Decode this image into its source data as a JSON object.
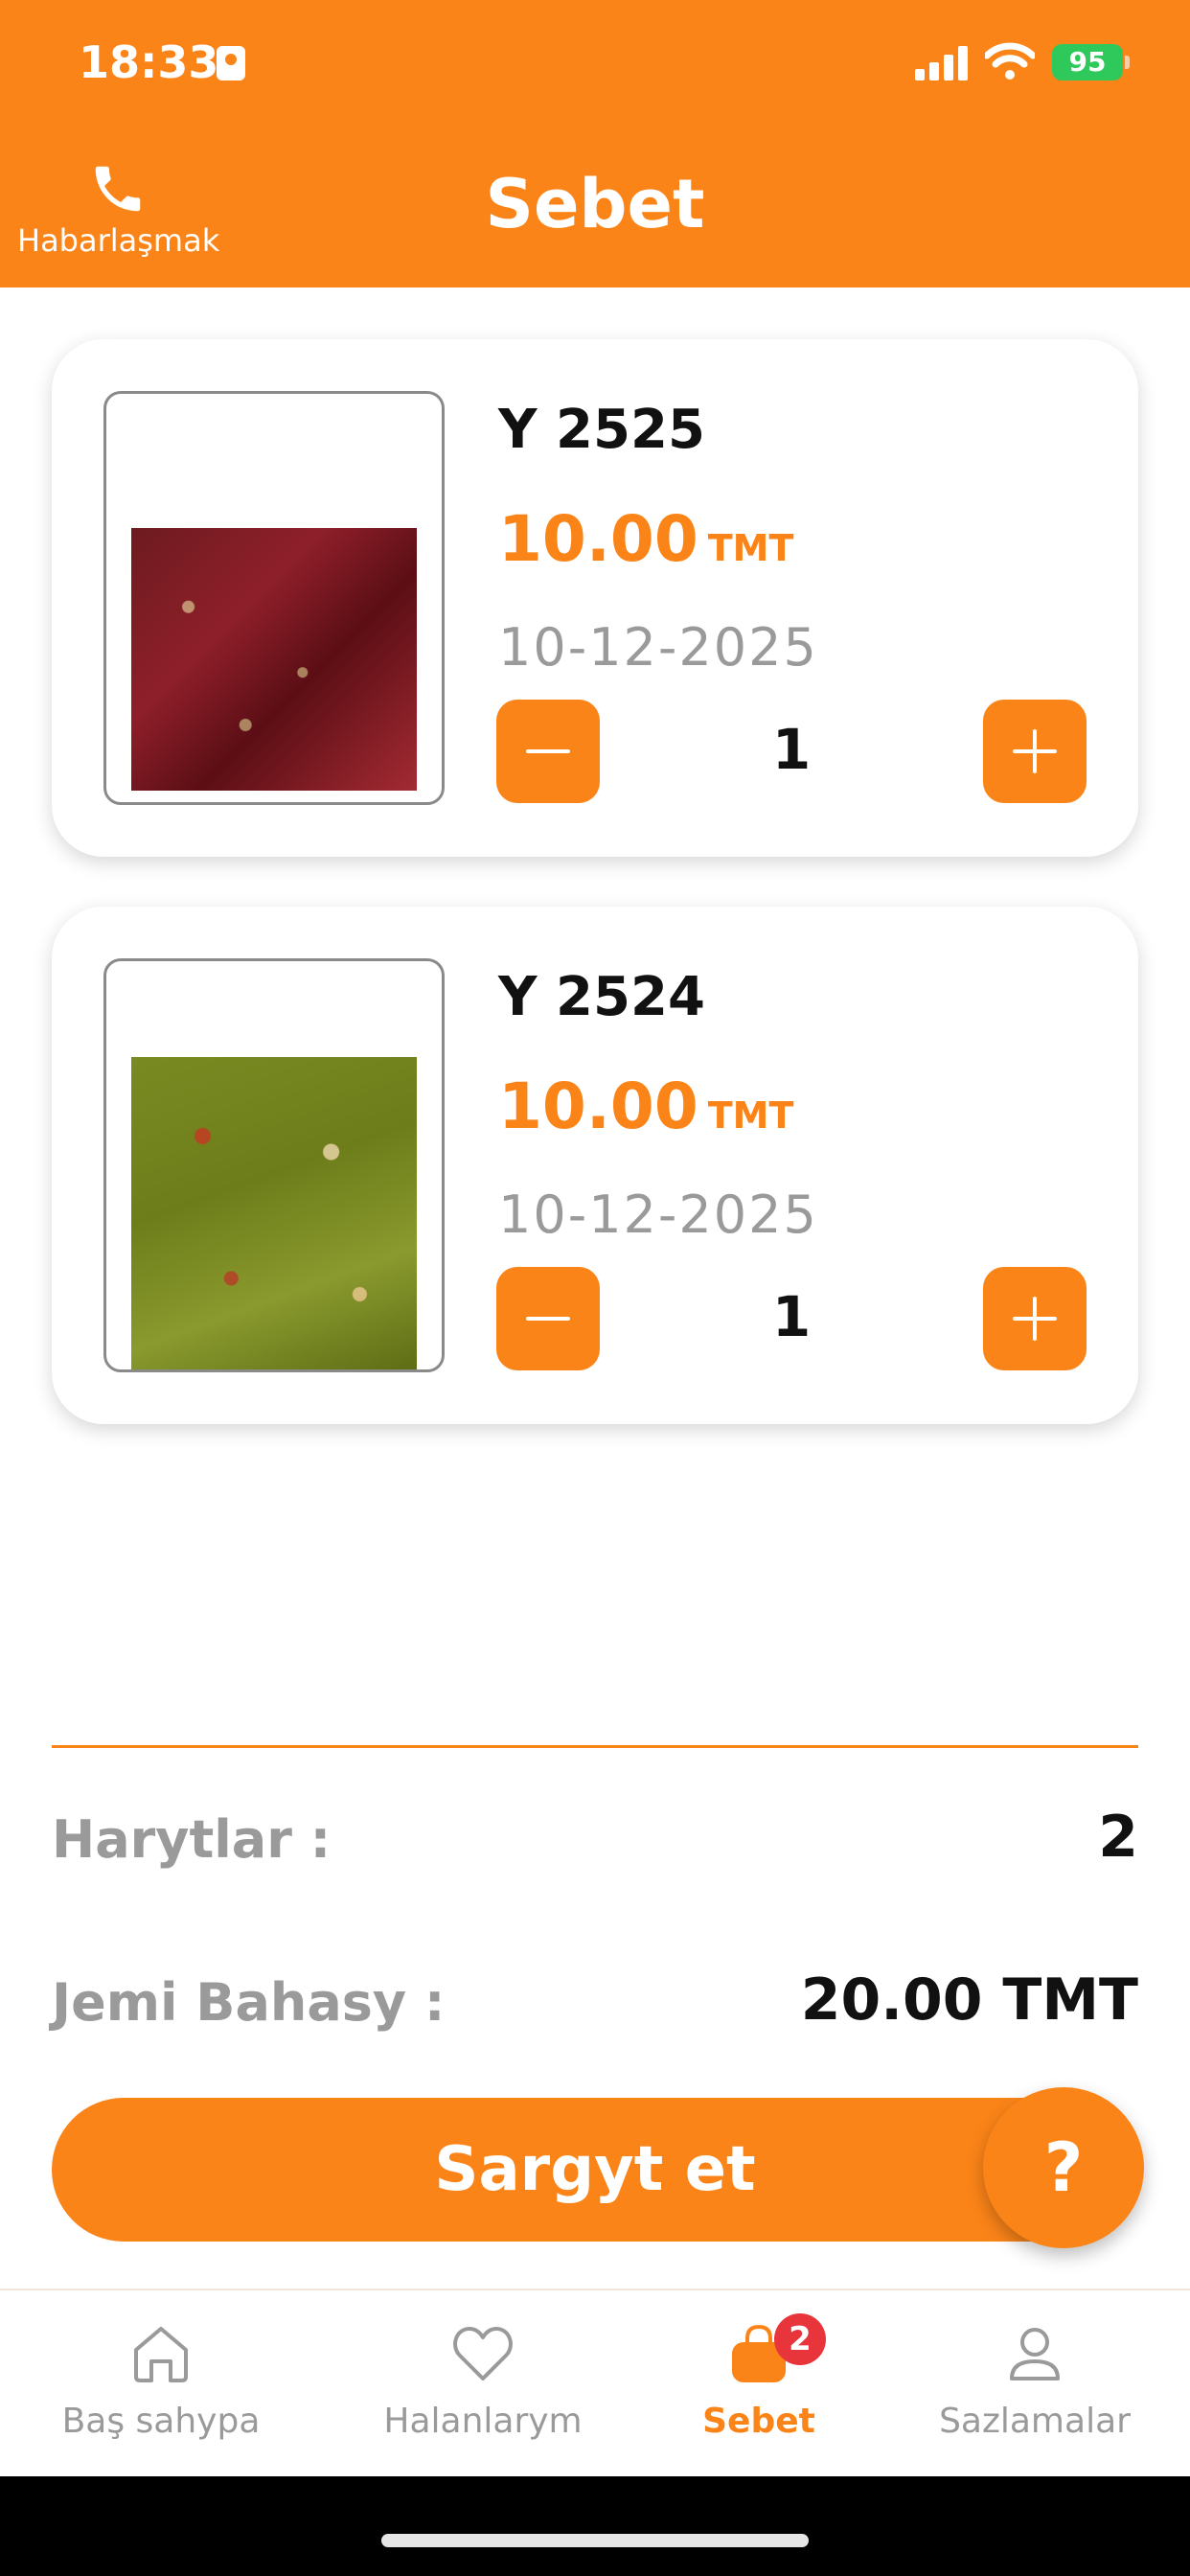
{
  "status_bar": {
    "time": "18:33",
    "battery": "95"
  },
  "header": {
    "title": "Sebet",
    "contact_label": "Habarlaşmak"
  },
  "cart": {
    "items": [
      {
        "name": "Y 2525",
        "price": "10.00",
        "currency": "TMT",
        "date": "10-12-2025",
        "quantity": "1"
      },
      {
        "name": "Y 2524",
        "price": "10.00",
        "currency": "TMT",
        "date": "10-12-2025",
        "quantity": "1"
      }
    ]
  },
  "summary": {
    "items_label": "Harytlar :",
    "items_count": "2",
    "total_label": "Jemi Bahasy :",
    "total_value": "20.00 TMT"
  },
  "order_button": "Sargyt et",
  "help_button": "?",
  "tabs": [
    {
      "label": "Baş sahypa",
      "icon": "home-icon"
    },
    {
      "label": "Halanlarym",
      "icon": "heart-icon"
    },
    {
      "label": "Sebet",
      "icon": "bag-icon",
      "badge": "2",
      "active": true
    },
    {
      "label": "Sazlamalar",
      "icon": "user-icon"
    }
  ],
  "colors": {
    "accent": "#FB8418",
    "badge": "#E8353B",
    "muted": "#9A9A9A"
  }
}
